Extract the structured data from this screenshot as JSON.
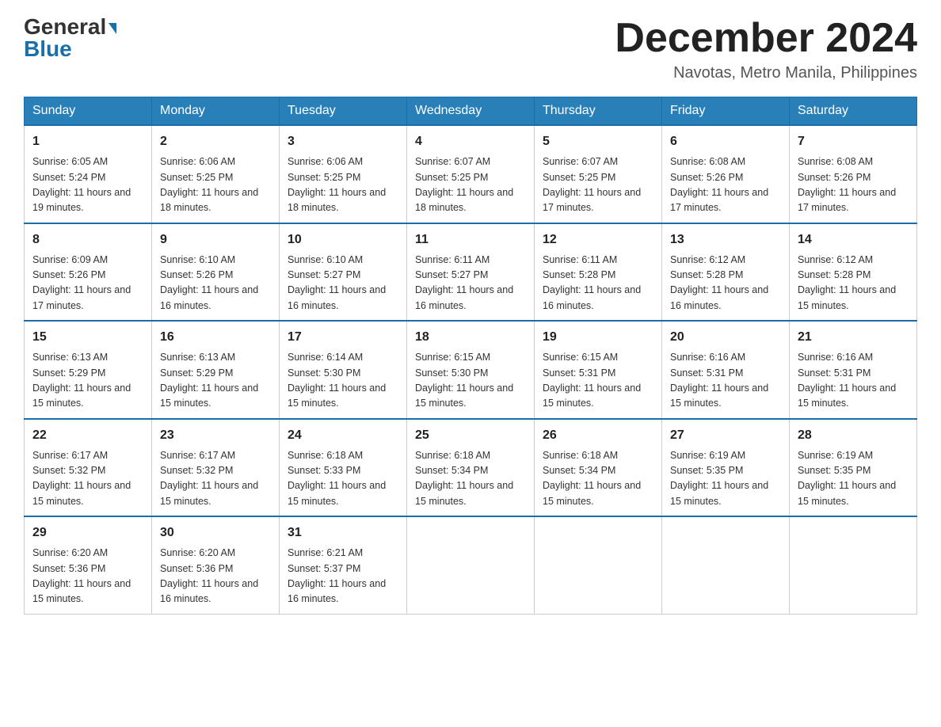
{
  "header": {
    "logo_general": "General",
    "logo_blue": "Blue",
    "month_title": "December 2024",
    "location": "Navotas, Metro Manila, Philippines"
  },
  "weekdays": [
    "Sunday",
    "Monday",
    "Tuesday",
    "Wednesday",
    "Thursday",
    "Friday",
    "Saturday"
  ],
  "weeks": [
    [
      {
        "day": "1",
        "sunrise": "6:05 AM",
        "sunset": "5:24 PM",
        "daylight": "11 hours and 19 minutes."
      },
      {
        "day": "2",
        "sunrise": "6:06 AM",
        "sunset": "5:25 PM",
        "daylight": "11 hours and 18 minutes."
      },
      {
        "day": "3",
        "sunrise": "6:06 AM",
        "sunset": "5:25 PM",
        "daylight": "11 hours and 18 minutes."
      },
      {
        "day": "4",
        "sunrise": "6:07 AM",
        "sunset": "5:25 PM",
        "daylight": "11 hours and 18 minutes."
      },
      {
        "day": "5",
        "sunrise": "6:07 AM",
        "sunset": "5:25 PM",
        "daylight": "11 hours and 17 minutes."
      },
      {
        "day": "6",
        "sunrise": "6:08 AM",
        "sunset": "5:26 PM",
        "daylight": "11 hours and 17 minutes."
      },
      {
        "day": "7",
        "sunrise": "6:08 AM",
        "sunset": "5:26 PM",
        "daylight": "11 hours and 17 minutes."
      }
    ],
    [
      {
        "day": "8",
        "sunrise": "6:09 AM",
        "sunset": "5:26 PM",
        "daylight": "11 hours and 17 minutes."
      },
      {
        "day": "9",
        "sunrise": "6:10 AM",
        "sunset": "5:26 PM",
        "daylight": "11 hours and 16 minutes."
      },
      {
        "day": "10",
        "sunrise": "6:10 AM",
        "sunset": "5:27 PM",
        "daylight": "11 hours and 16 minutes."
      },
      {
        "day": "11",
        "sunrise": "6:11 AM",
        "sunset": "5:27 PM",
        "daylight": "11 hours and 16 minutes."
      },
      {
        "day": "12",
        "sunrise": "6:11 AM",
        "sunset": "5:28 PM",
        "daylight": "11 hours and 16 minutes."
      },
      {
        "day": "13",
        "sunrise": "6:12 AM",
        "sunset": "5:28 PM",
        "daylight": "11 hours and 16 minutes."
      },
      {
        "day": "14",
        "sunrise": "6:12 AM",
        "sunset": "5:28 PM",
        "daylight": "11 hours and 15 minutes."
      }
    ],
    [
      {
        "day": "15",
        "sunrise": "6:13 AM",
        "sunset": "5:29 PM",
        "daylight": "11 hours and 15 minutes."
      },
      {
        "day": "16",
        "sunrise": "6:13 AM",
        "sunset": "5:29 PM",
        "daylight": "11 hours and 15 minutes."
      },
      {
        "day": "17",
        "sunrise": "6:14 AM",
        "sunset": "5:30 PM",
        "daylight": "11 hours and 15 minutes."
      },
      {
        "day": "18",
        "sunrise": "6:15 AM",
        "sunset": "5:30 PM",
        "daylight": "11 hours and 15 minutes."
      },
      {
        "day": "19",
        "sunrise": "6:15 AM",
        "sunset": "5:31 PM",
        "daylight": "11 hours and 15 minutes."
      },
      {
        "day": "20",
        "sunrise": "6:16 AM",
        "sunset": "5:31 PM",
        "daylight": "11 hours and 15 minutes."
      },
      {
        "day": "21",
        "sunrise": "6:16 AM",
        "sunset": "5:31 PM",
        "daylight": "11 hours and 15 minutes."
      }
    ],
    [
      {
        "day": "22",
        "sunrise": "6:17 AM",
        "sunset": "5:32 PM",
        "daylight": "11 hours and 15 minutes."
      },
      {
        "day": "23",
        "sunrise": "6:17 AM",
        "sunset": "5:32 PM",
        "daylight": "11 hours and 15 minutes."
      },
      {
        "day": "24",
        "sunrise": "6:18 AM",
        "sunset": "5:33 PM",
        "daylight": "11 hours and 15 minutes."
      },
      {
        "day": "25",
        "sunrise": "6:18 AM",
        "sunset": "5:34 PM",
        "daylight": "11 hours and 15 minutes."
      },
      {
        "day": "26",
        "sunrise": "6:18 AM",
        "sunset": "5:34 PM",
        "daylight": "11 hours and 15 minutes."
      },
      {
        "day": "27",
        "sunrise": "6:19 AM",
        "sunset": "5:35 PM",
        "daylight": "11 hours and 15 minutes."
      },
      {
        "day": "28",
        "sunrise": "6:19 AM",
        "sunset": "5:35 PM",
        "daylight": "11 hours and 15 minutes."
      }
    ],
    [
      {
        "day": "29",
        "sunrise": "6:20 AM",
        "sunset": "5:36 PM",
        "daylight": "11 hours and 15 minutes."
      },
      {
        "day": "30",
        "sunrise": "6:20 AM",
        "sunset": "5:36 PM",
        "daylight": "11 hours and 16 minutes."
      },
      {
        "day": "31",
        "sunrise": "6:21 AM",
        "sunset": "5:37 PM",
        "daylight": "11 hours and 16 minutes."
      },
      null,
      null,
      null,
      null
    ]
  ],
  "labels": {
    "sunrise": "Sunrise: ",
    "sunset": "Sunset: ",
    "daylight": "Daylight: "
  }
}
